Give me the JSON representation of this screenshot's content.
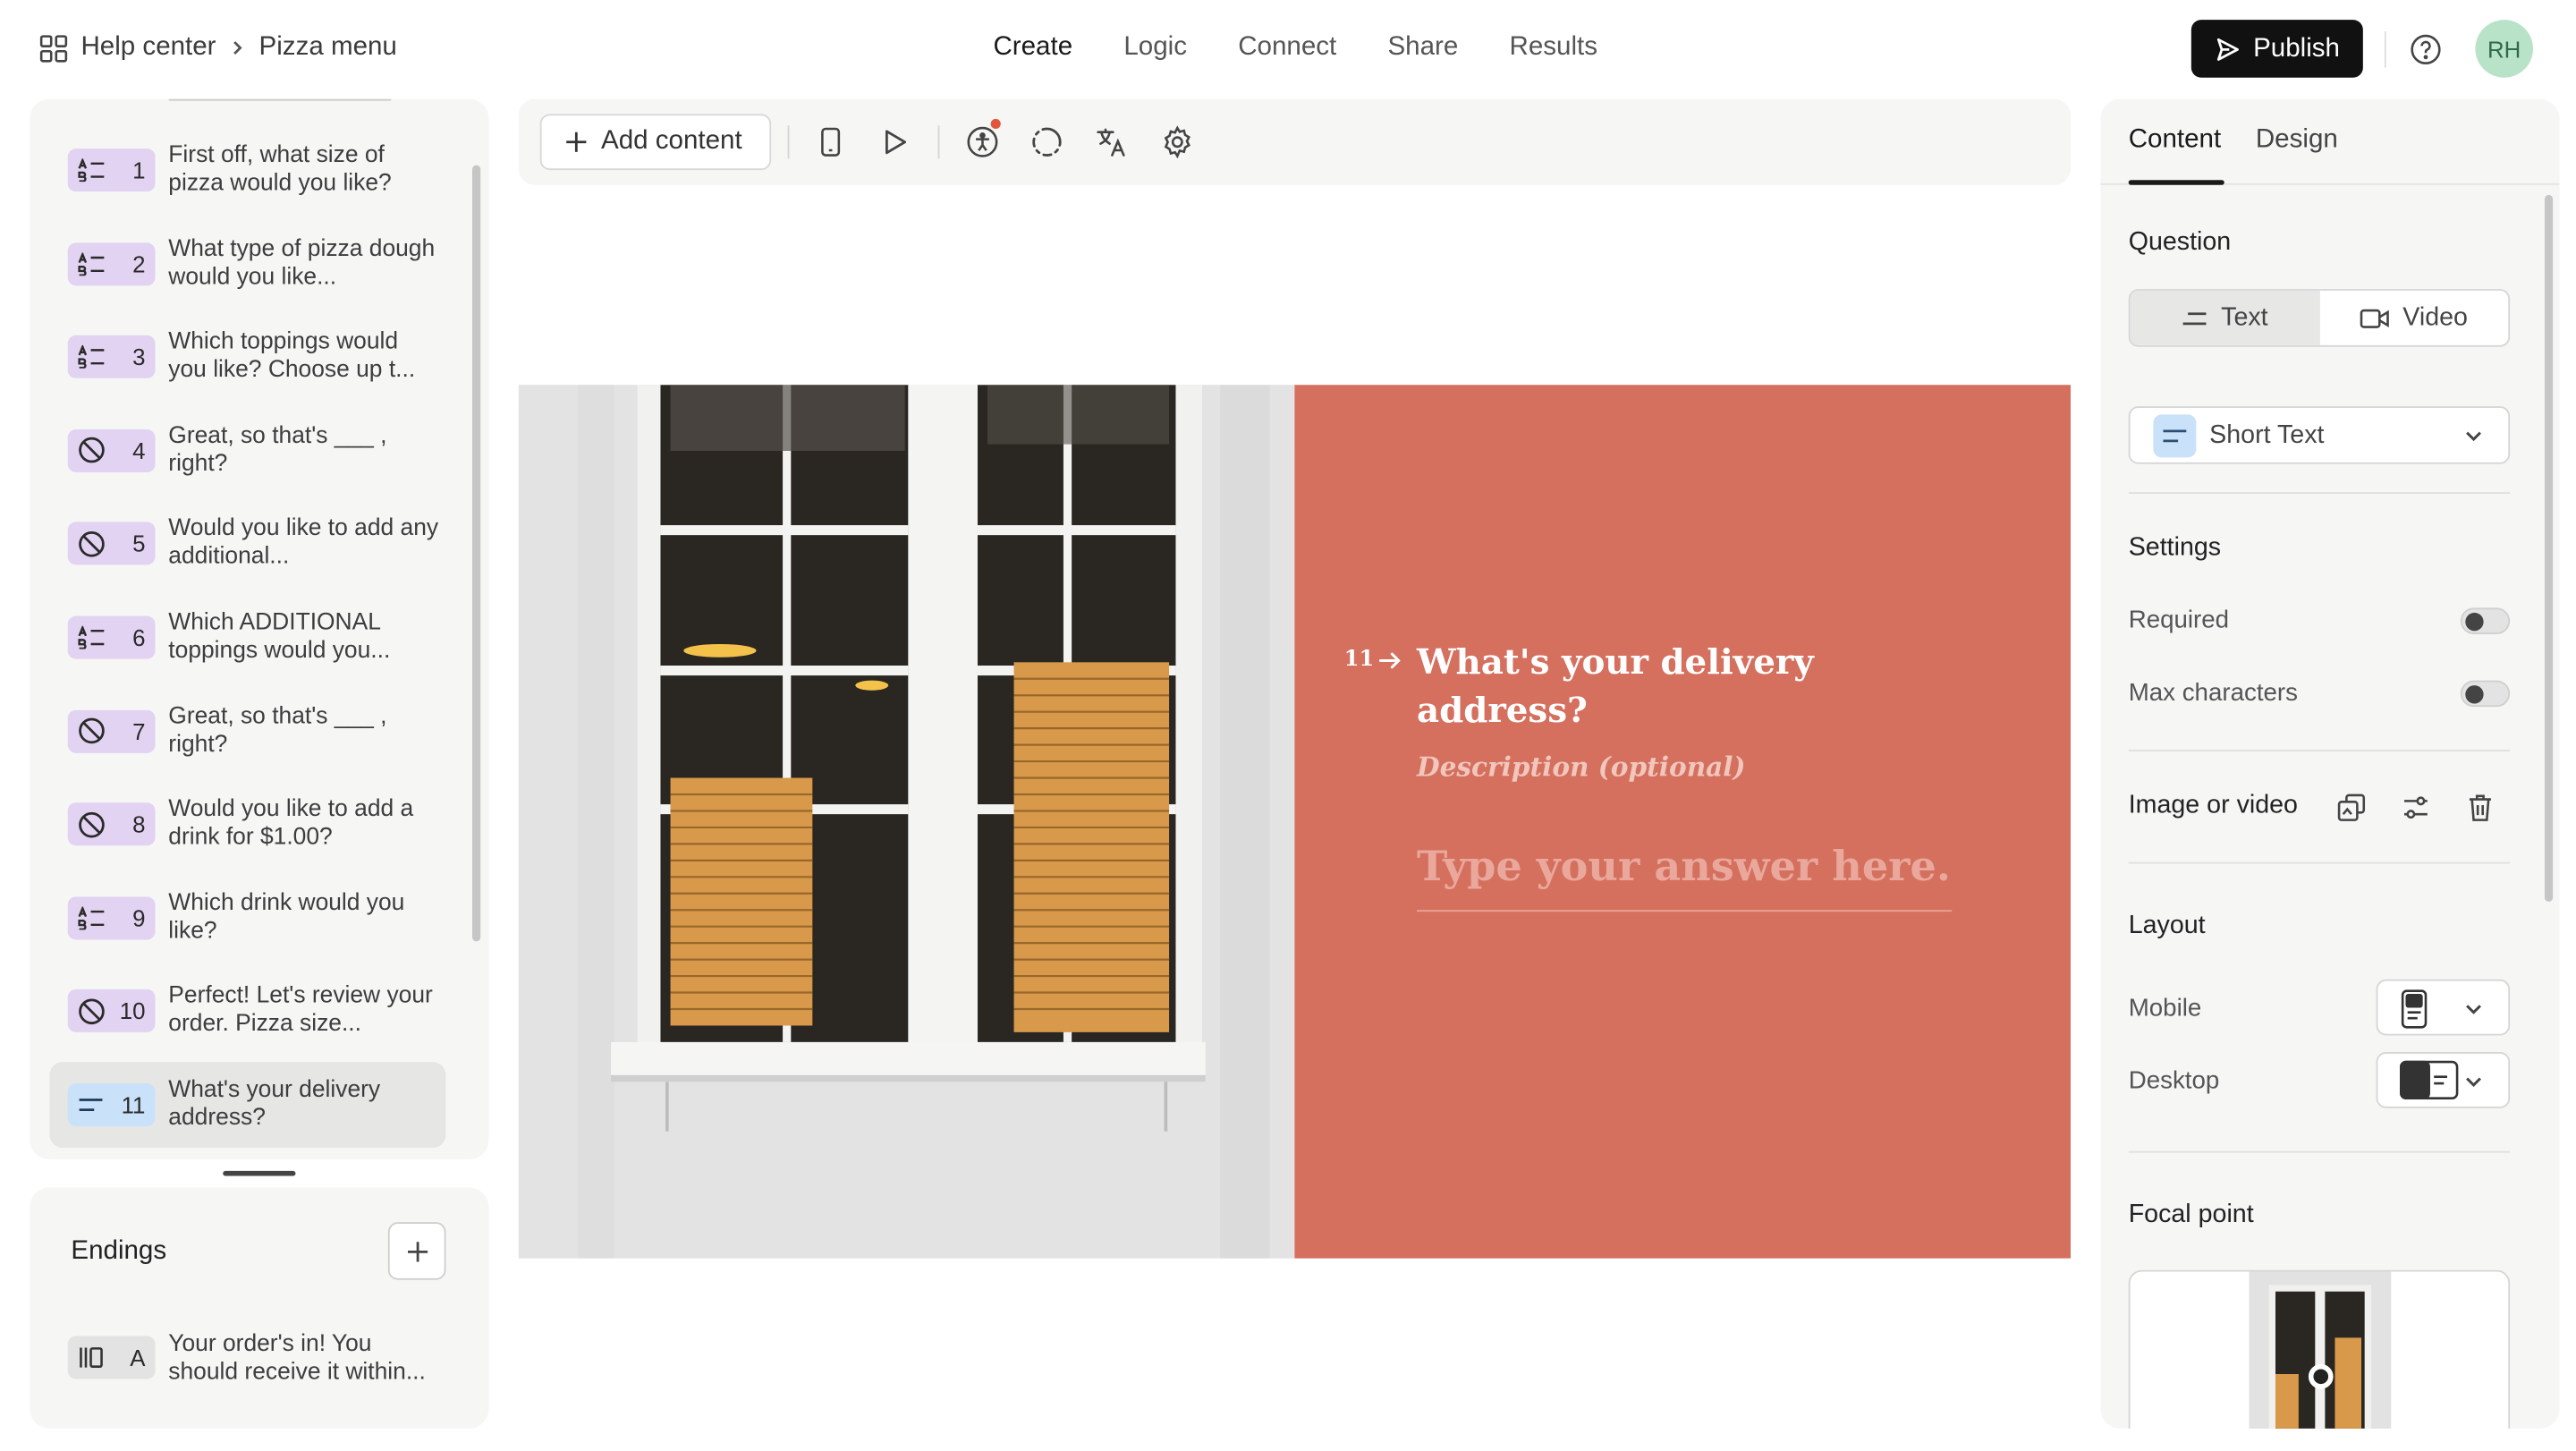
{
  "breadcrumb": {
    "root": "Help center",
    "current": "Pizza menu"
  },
  "nav": {
    "tabs": [
      "Create",
      "Logic",
      "Connect",
      "Share",
      "Results"
    ],
    "active": "Create"
  },
  "topbar": {
    "publish_label": "Publish",
    "avatar_initials": "RH"
  },
  "questions": [
    {
      "num": "1",
      "text": "First off, what size of pizza would you like?",
      "type": "multiple-choice"
    },
    {
      "num": "2",
      "text": "What type of pizza dough would you like...",
      "type": "multiple-choice"
    },
    {
      "num": "3",
      "text": "Which toppings would you like? Choose up t...",
      "type": "multiple-choice"
    },
    {
      "num": "4",
      "text": "Great, so that's ___ , right?",
      "type": "statement"
    },
    {
      "num": "5",
      "text": "Would you like to add any additional...",
      "type": "statement"
    },
    {
      "num": "6",
      "text": "Which ADDITIONAL toppings would you...",
      "type": "multiple-choice"
    },
    {
      "num": "7",
      "text": "Great, so that's ___ , right?",
      "type": "statement"
    },
    {
      "num": "8",
      "text": "Would you like to add a drink for $1.00?",
      "type": "statement"
    },
    {
      "num": "9",
      "text": "Which drink would you like?",
      "type": "multiple-choice"
    },
    {
      "num": "10",
      "text": "Perfect! Let's review your order. Pizza size...",
      "type": "statement"
    },
    {
      "num": "11",
      "text": "What's your delivery address?",
      "type": "short-text"
    }
  ],
  "endings": {
    "title": "Endings",
    "items": [
      {
        "letter": "A",
        "text": "Your order's in! You should receive it within..."
      }
    ]
  },
  "toolbar": {
    "add_content_label": "Add content"
  },
  "preview": {
    "number": "11",
    "title": "What's your delivery address?",
    "description": "Description (optional)",
    "answer_placeholder": "Type your answer here..",
    "accent_color": "#d5705f"
  },
  "right_panel": {
    "tabs": [
      "Content",
      "Design"
    ],
    "active_tab": "Content",
    "question_label": "Question",
    "question_types": [
      "Text",
      "Video"
    ],
    "active_question_type": "Text",
    "answer_type": "Short Text",
    "settings_label": "Settings",
    "required_label": "Required",
    "max_characters_label": "Max characters",
    "required_on": false,
    "max_characters_on": false,
    "image_video_label": "Image or video",
    "layout_label": "Layout",
    "mobile_label": "Mobile",
    "desktop_label": "Desktop",
    "focal_point_label": "Focal point"
  }
}
